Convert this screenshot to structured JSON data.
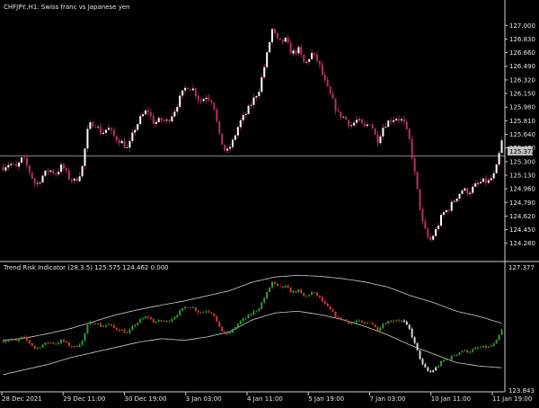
{
  "colors": {
    "background": "#000000",
    "text": "#e6e6e6",
    "axis": "#cfcfcf",
    "main_candle": "#ffffff",
    "main_wick": "#b83060",
    "bull": "#2f9e2f",
    "bear": "#d43a2a",
    "neutral": "#d8d8d8",
    "band": "#cfcfcf",
    "price_line": "#8a8a8a",
    "badge": "#c0c0c0"
  },
  "chart_data": [
    {
      "type": "candlestick",
      "title": "CHFJPY.,H1:  Swiss franc vs Japanese yen",
      "ylim": [
        124.12,
        127.16
      ],
      "y_ticks": [
        "127.000",
        "126.830",
        "126.660",
        "126.490",
        "126.320",
        "126.150",
        "125.980",
        "125.810",
        "125.640",
        "125.470",
        "125.300",
        "125.130",
        "124.960",
        "124.790",
        "124.620",
        "124.450",
        "124.280"
      ],
      "current_price": "125.372",
      "price_line": 125.37,
      "path": [
        125.23,
        125.28,
        125.22,
        125.35,
        125.18,
        125.0,
        125.12,
        125.2,
        125.15,
        125.25,
        125.1,
        125.05,
        125.2,
        125.75,
        125.78,
        125.65,
        125.72,
        125.6,
        125.55,
        125.45,
        125.7,
        125.85,
        125.95,
        125.78,
        125.82,
        125.8,
        125.92,
        126.1,
        126.25,
        126.2,
        126.05,
        126.12,
        126.05,
        125.6,
        125.4,
        125.55,
        125.78,
        125.9,
        126.05,
        126.2,
        126.55,
        126.95,
        126.78,
        126.82,
        126.65,
        126.7,
        126.5,
        126.65,
        126.55,
        126.3,
        126.1,
        125.9,
        125.85,
        125.75,
        125.82,
        125.72,
        125.8,
        125.55,
        125.75,
        125.82,
        125.85,
        125.8,
        125.55,
        125.0,
        124.5,
        124.3,
        124.45,
        124.65,
        124.72,
        124.85,
        124.95,
        124.92,
        125.0,
        125.05,
        125.05,
        125.15,
        125.55
      ]
    },
    {
      "type": "candlestick_with_bands",
      "title": "Trend Risk Indicator (28,3.5) 125.575 124.462 0.000",
      "ylim": [
        123.8,
        127.42
      ],
      "y_ticks": [
        "127.377",
        "123.843"
      ],
      "upper_band": [
        125.25,
        125.32,
        125.45,
        125.6,
        125.8,
        126.0,
        126.15,
        126.28,
        126.4,
        126.55,
        126.7,
        126.95,
        127.1,
        127.15,
        127.12,
        127.05,
        126.95,
        126.8,
        126.55,
        126.35,
        126.1,
        125.95,
        125.75
      ],
      "lower_band": [
        124.25,
        124.4,
        124.55,
        124.75,
        124.9,
        125.05,
        125.2,
        125.3,
        125.25,
        125.35,
        125.5,
        125.85,
        126.05,
        126.1,
        126.0,
        125.85,
        125.65,
        125.4,
        125.1,
        124.85,
        124.6,
        124.5,
        124.45
      ],
      "candle_colors": "bull/bear coloured where price trends above/below bands; grey after crossing below lower band"
    }
  ],
  "x_labels": [
    "28 Dec 2021",
    "29 Dec 11:00",
    "30 Dec 19:00",
    "3 Jan 03:00",
    "4 Jan 11:00",
    "5 Jan 19:00",
    "7 Jan 03:00",
    "10 Jan 11:00",
    "11 Jan 19:00"
  ]
}
